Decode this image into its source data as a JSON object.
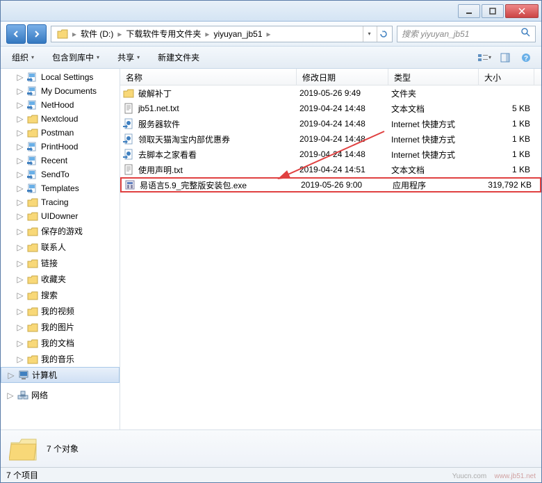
{
  "breadcrumb": {
    "items": [
      "软件 (D:)",
      "下载软件专用文件夹",
      "yiyuyan_jb51"
    ]
  },
  "search": {
    "placeholder": "搜索 yiyuyan_jb51"
  },
  "toolbar": {
    "organize": "组织",
    "include": "包含到库中",
    "share": "共享",
    "newfolder": "新建文件夹"
  },
  "columns": {
    "name": "名称",
    "date": "修改日期",
    "type": "类型",
    "size": "大小"
  },
  "sidebar": {
    "items": [
      {
        "label": "Local Settings",
        "icon": "shortcut"
      },
      {
        "label": "My Documents",
        "icon": "shortcut"
      },
      {
        "label": "NetHood",
        "icon": "shortcut"
      },
      {
        "label": "Nextcloud",
        "icon": "folder"
      },
      {
        "label": "Postman",
        "icon": "folder"
      },
      {
        "label": "PrintHood",
        "icon": "shortcut"
      },
      {
        "label": "Recent",
        "icon": "shortcut"
      },
      {
        "label": "SendTo",
        "icon": "shortcut"
      },
      {
        "label": "Templates",
        "icon": "shortcut"
      },
      {
        "label": "Tracing",
        "icon": "folder"
      },
      {
        "label": "UIDowner",
        "icon": "folder"
      },
      {
        "label": "保存的游戏",
        "icon": "folder"
      },
      {
        "label": "联系人",
        "icon": "folder"
      },
      {
        "label": "链接",
        "icon": "folder"
      },
      {
        "label": "收藏夹",
        "icon": "folder"
      },
      {
        "label": "搜索",
        "icon": "folder"
      },
      {
        "label": "我的视频",
        "icon": "folder"
      },
      {
        "label": "我的图片",
        "icon": "folder"
      },
      {
        "label": "我的文档",
        "icon": "folder"
      },
      {
        "label": "我的音乐",
        "icon": "folder"
      }
    ],
    "computer": "计算机",
    "network": "网络"
  },
  "files": [
    {
      "name": "破解补丁",
      "date": "2019-05-26 9:49",
      "type": "文件夹",
      "size": "",
      "icon": "folder",
      "highlight": false
    },
    {
      "name": "jb51.net.txt",
      "date": "2019-04-24 14:48",
      "type": "文本文档",
      "size": "5 KB",
      "icon": "txt",
      "highlight": false
    },
    {
      "name": "服务器软件",
      "date": "2019-04-24 14:48",
      "type": "Internet 快捷方式",
      "size": "1 KB",
      "icon": "url",
      "highlight": false
    },
    {
      "name": "领取天猫淘宝内部优惠券",
      "date": "2019-04-24 14:48",
      "type": "Internet 快捷方式",
      "size": "1 KB",
      "icon": "url",
      "highlight": false
    },
    {
      "name": "去脚本之家看看",
      "date": "2019-04-24 14:48",
      "type": "Internet 快捷方式",
      "size": "1 KB",
      "icon": "url",
      "highlight": false
    },
    {
      "name": "使用声明.txt",
      "date": "2019-04-24 14:51",
      "type": "文本文档",
      "size": "1 KB",
      "icon": "txt",
      "highlight": false
    },
    {
      "name": "易语言5.9_完整版安装包.exe",
      "date": "2019-05-26 9:00",
      "type": "应用程序",
      "size": "319,792 KB",
      "icon": "exe",
      "highlight": true
    }
  ],
  "details": {
    "count": "7 个对象"
  },
  "status": {
    "items": "7 个项目",
    "watermark1": "Yuucn.com",
    "watermark2": "www.jb51.net"
  }
}
